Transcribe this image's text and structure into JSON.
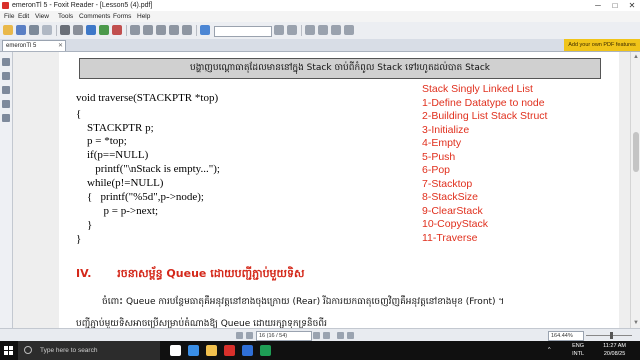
{
  "window": {
    "title": "emeronTl 5 - Foxit Reader - [Lesson5 (4).pdf]",
    "controls": [
      "─",
      "□",
      "✕"
    ]
  },
  "menu": {
    "items": [
      "File",
      "Edit",
      "View",
      "Tools",
      "Comments",
      "Forms",
      "Help"
    ]
  },
  "tab": {
    "label": "emeronTl 5",
    "close": "✕"
  },
  "ad": {
    "text": "Add your own PDF features"
  },
  "document": {
    "banner": "បង្ហាញបណ្តោធាតុដែលមាននៅក្នុង Stack ចាប់ពីកំពូល Stack ទៅរហូតដល់បាត Stack",
    "code": [
      "void traverse(STACKPTR *top)",
      "{",
      "    STACKPTR p;",
      "    p = *top;",
      "    if(p==NULL)",
      "       printf(\"\\nStack is empty...\");",
      "    while(p!=NULL)",
      "    {   printf(\"%5d\",p->node);",
      "          p = p->next;",
      "    }",
      "}"
    ],
    "stack_list": [
      "Stack Singly Linked List",
      "1-Define Datatype to node",
      "2-Building List Stack Struct",
      "3-Initialize",
      "4-Empty",
      "5-Push",
      "6-Pop",
      "7-Stacktop",
      "8-StackSize",
      "9-ClearStack",
      "10-CopyStack",
      "11-Traverse"
    ],
    "heading_num": "IV.",
    "heading": "រចនាសម្ព័ន្ធ Queue ដោយបញ្ជីភ្ជាប់មួយទិស",
    "para1": "ចំពោះ Queue ការបន្ថែមធាតុគឺអនុវត្តនៅខាងចុងក្រោយ (Rear) រីឯការយកធាតុចេញវិញគឺអនុវត្តនៅខាងមុខ (Front) ។",
    "para2": "បញ្ជីភ្ជាប់មួយទិសអាចប្រើសម្រាប់តំណាងឱ្យ Queue ដោយរក្សាទុកទ្រនិចពីរ"
  },
  "statusbar": {
    "page": "16 (16 / 54)",
    "zoom": "164.44%"
  },
  "taskbar": {
    "search_placeholder": "Type here to search",
    "lang": "ENG",
    "lang2": "INTL",
    "time": "11:27 AM",
    "date": "20/08/25"
  },
  "icons": {
    "app": "foxit-icon",
    "start": "windows-start-icon",
    "search": "search-icon"
  },
  "colors": {
    "accent_red": "#e0301e",
    "ad_bar": "#f0c419",
    "taskbar": "#101010"
  }
}
